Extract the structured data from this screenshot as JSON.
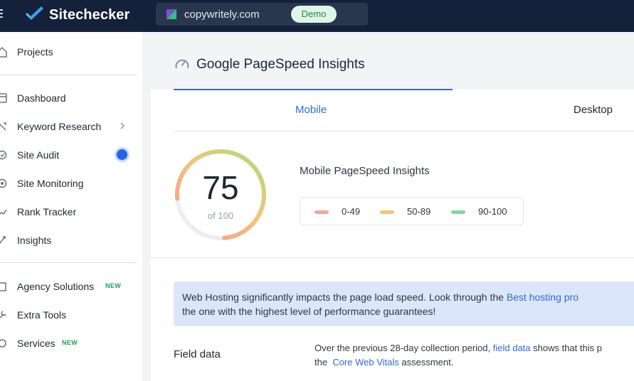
{
  "app": {
    "brand": "Sitechecker",
    "project_domain": "copywritely.com",
    "demo_label": "Demo"
  },
  "sidebar": {
    "items": [
      {
        "label": "Projects",
        "icon": "home-icon"
      },
      {
        "label": "Dashboard",
        "icon": "dashboard-icon"
      },
      {
        "label": "Keyword Research",
        "icon": "keyword-icon"
      },
      {
        "label": "Site Audit",
        "icon": "audit-icon"
      },
      {
        "label": "Site Monitoring",
        "icon": "monitoring-icon"
      },
      {
        "label": "Rank Tracker",
        "icon": "rank-icon"
      },
      {
        "label": "Insights",
        "icon": "insights-icon"
      },
      {
        "label": "Agency Solutions",
        "icon": "agency-icon",
        "badge": "NEW"
      },
      {
        "label": "Extra Tools",
        "icon": "tools-icon"
      },
      {
        "label": "Services",
        "icon": "services-icon",
        "badge": "NEW"
      }
    ]
  },
  "main": {
    "title": "Google PageSpeed Insights",
    "tabs": [
      {
        "label": "Mobile",
        "active": true
      },
      {
        "label": "Desktop",
        "active": false
      }
    ],
    "score": {
      "value": "75",
      "of_label": "of 100",
      "fraction": 0.75
    },
    "insights_label": "Mobile PageSpeed Insights",
    "legend": [
      {
        "label": "0-49",
        "color": "#f4a59b"
      },
      {
        "label": "50-89",
        "color": "#f6c27a"
      },
      {
        "label": "90-100",
        "color": "#7fd99f"
      }
    ],
    "banner": {
      "text_before": "Web Hosting significantly impacts the page load speed. Look through the ",
      "link": "Best hosting pro",
      "text_after": "the one with the highest level of performance guarantees!"
    },
    "field_data": {
      "title": "Field data",
      "line1_before": "Over the previous 28-day collection period, ",
      "line1_link": "field data",
      "line1_after": " shows that this p",
      "line2_before": "the ",
      "line2_link": "Core Web Vitals",
      "line2_after": " assessment."
    }
  },
  "colors": {
    "topbar": "#14213a",
    "accent": "#2f6bd6",
    "new_badge": "#1aa055",
    "banner": "#dbe6fb"
  }
}
